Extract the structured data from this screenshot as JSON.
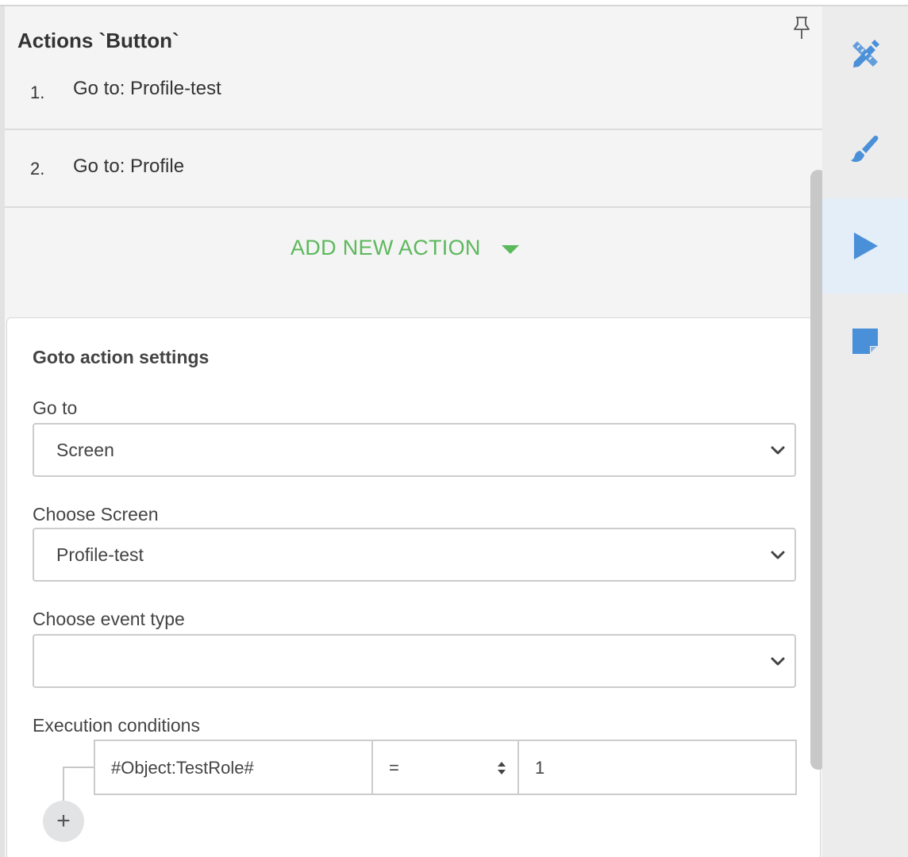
{
  "panel": {
    "title": "Actions `Button`",
    "actions": [
      {
        "number": "1.",
        "label": "Go to: Profile-test"
      },
      {
        "number": "2.",
        "label": "Go to: Profile"
      }
    ],
    "add_action_label": "ADD NEW ACTION"
  },
  "settings": {
    "title": "Goto action settings",
    "goto_label": "Go to",
    "goto_value": "Screen",
    "screen_label": "Choose Screen",
    "screen_value": "Profile-test",
    "event_label": "Choose event type",
    "event_value": "",
    "conditions_label": "Execution conditions",
    "condition": {
      "object": "#Object:TestRole#",
      "operator": "=",
      "value": "1"
    },
    "add_condition_symbol": "+"
  },
  "sidebar": {
    "items": [
      {
        "icon": "design-tools-icon",
        "active": false
      },
      {
        "icon": "brush-icon",
        "active": false
      },
      {
        "icon": "play-icon",
        "active": true
      },
      {
        "icon": "note-icon",
        "active": false
      }
    ]
  },
  "colors": {
    "accent_green": "#5cb85c",
    "icon_blue": "#4a90d9",
    "active_bg": "#e3eef8"
  }
}
